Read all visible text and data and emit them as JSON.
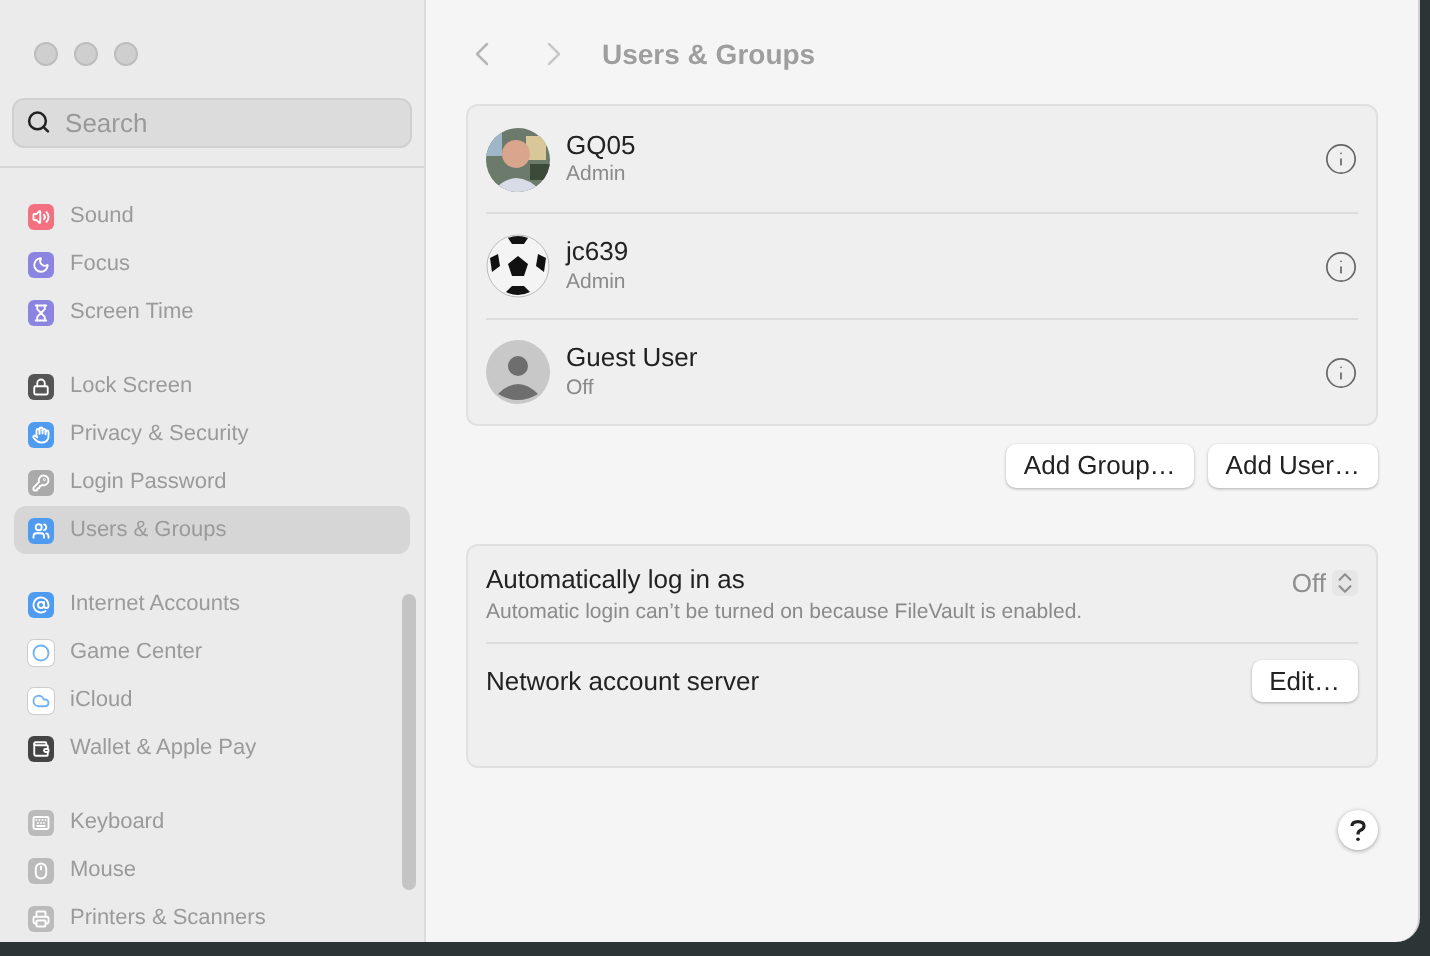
{
  "search": {
    "placeholder": "Search"
  },
  "sidebar": {
    "groups": [
      [
        {
          "label": "Sound",
          "color": "#f2707f",
          "selected": false
        },
        {
          "label": "Focus",
          "color": "#8b84e0",
          "selected": false
        },
        {
          "label": "Screen Time",
          "color": "#8b84e0",
          "selected": false
        }
      ],
      [
        {
          "label": "Lock Screen",
          "color": "#555555",
          "selected": false
        },
        {
          "label": "Privacy & Security",
          "color": "#4f9bf0",
          "selected": false
        },
        {
          "label": "Login Password",
          "color": "#aaaaaa",
          "selected": false
        },
        {
          "label": "Users & Groups",
          "color": "#4f9bf0",
          "selected": true
        }
      ],
      [
        {
          "label": "Internet Accounts",
          "color": "#4f9bf0",
          "selected": false
        },
        {
          "label": "Game Center",
          "color": "#ffffff",
          "selected": false
        },
        {
          "label": "iCloud",
          "color": "#ffffff",
          "selected": false
        },
        {
          "label": "Wallet & Apple Pay",
          "color": "#444444",
          "selected": false
        }
      ],
      [
        {
          "label": "Keyboard",
          "color": "#bbbbbb",
          "selected": false
        },
        {
          "label": "Mouse",
          "color": "#bbbbbb",
          "selected": false
        },
        {
          "label": "Printers & Scanners",
          "color": "#bbbbbb",
          "selected": false
        }
      ]
    ]
  },
  "header": {
    "title": "Users & Groups"
  },
  "users": [
    {
      "name": "GQ05",
      "role": "Admin"
    },
    {
      "name": "jc639",
      "role": "Admin",
      "kind": "ball"
    },
    {
      "name": "Guest User",
      "role": "Off",
      "kind": "generic"
    }
  ],
  "user_buttons": [
    "Add Group…",
    "Add User…"
  ],
  "login": {
    "title": "Automatically log in as",
    "note": "Automatic login can’t be turned on because FileVault is enabled.",
    "value": "Off",
    "disabled": true
  },
  "network": {
    "title": "Network account server",
    "button": "Edit…"
  }
}
